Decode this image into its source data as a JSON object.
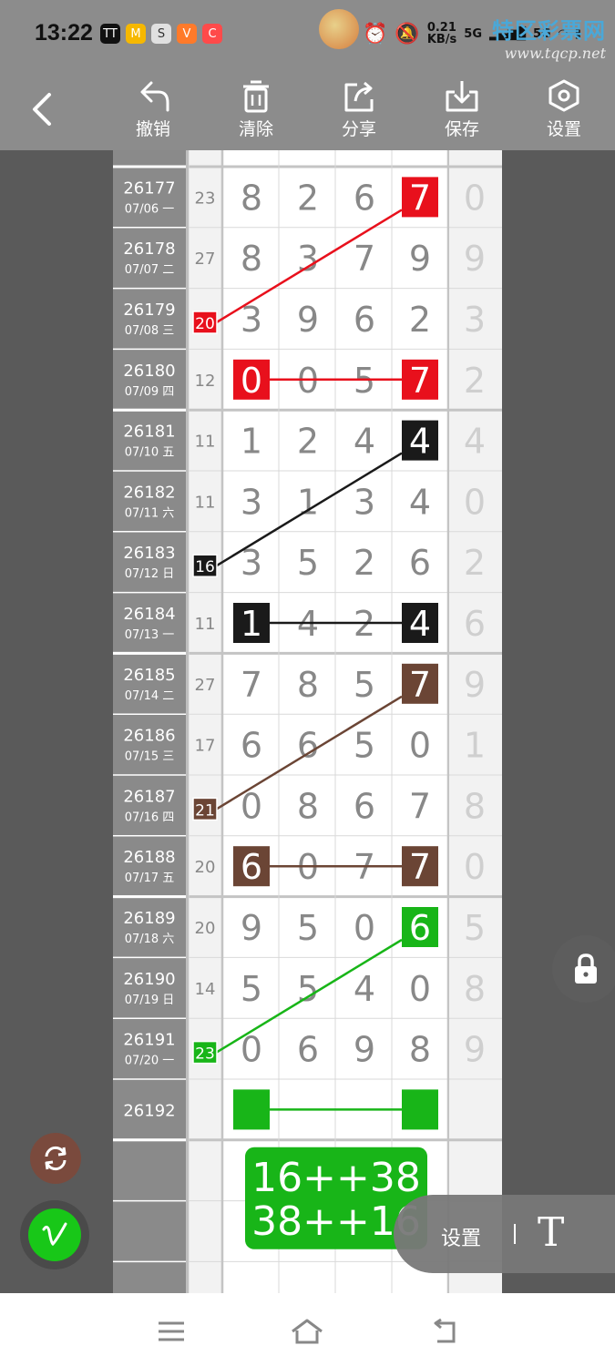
{
  "status": {
    "time": "13:22",
    "app_icons": [
      "TT",
      "M",
      "S",
      "V",
      "C"
    ],
    "speed_value": "0.21",
    "speed_unit": "KB/s",
    "net1": "5G",
    "net2": "5G"
  },
  "watermark": {
    "title": "特区彩票网",
    "url": "www.tqcp.net"
  },
  "toolbar": {
    "undo": "撤销",
    "clear": "清除",
    "share": "分享",
    "save": "保存",
    "settings": "设置"
  },
  "rows": [
    {
      "issue": "26177",
      "date": "07/06 一",
      "sum": "23",
      "digits": [
        "8",
        "2",
        "6",
        "7"
      ],
      "next": "0"
    },
    {
      "issue": "26178",
      "date": "07/07 二",
      "sum": "27",
      "digits": [
        "8",
        "3",
        "7",
        "9"
      ],
      "next": "9"
    },
    {
      "issue": "26179",
      "date": "07/08 三",
      "sum": "20",
      "digits": [
        "3",
        "9",
        "6",
        "2"
      ],
      "next": "3"
    },
    {
      "issue": "26180",
      "date": "07/09 四",
      "sum": "12",
      "digits": [
        "0",
        "0",
        "5",
        "7"
      ],
      "next": "2"
    },
    {
      "issue": "26181",
      "date": "07/10 五",
      "sum": "11",
      "digits": [
        "1",
        "2",
        "4",
        "4"
      ],
      "next": "4"
    },
    {
      "issue": "26182",
      "date": "07/11 六",
      "sum": "11",
      "digits": [
        "3",
        "1",
        "3",
        "4"
      ],
      "next": "0"
    },
    {
      "issue": "26183",
      "date": "07/12 日",
      "sum": "16",
      "digits": [
        "3",
        "5",
        "2",
        "6"
      ],
      "next": "2"
    },
    {
      "issue": "26184",
      "date": "07/13 一",
      "sum": "11",
      "digits": [
        "1",
        "4",
        "2",
        "4"
      ],
      "next": "6"
    },
    {
      "issue": "26185",
      "date": "07/14 二",
      "sum": "27",
      "digits": [
        "7",
        "8",
        "5",
        "7"
      ],
      "next": "9"
    },
    {
      "issue": "26186",
      "date": "07/15 三",
      "sum": "17",
      "digits": [
        "6",
        "6",
        "5",
        "0"
      ],
      "next": "1"
    },
    {
      "issue": "26187",
      "date": "07/16 四",
      "sum": "21",
      "digits": [
        "0",
        "8",
        "6",
        "7"
      ],
      "next": "8"
    },
    {
      "issue": "26188",
      "date": "07/17 五",
      "sum": "20",
      "digits": [
        "6",
        "0",
        "7",
        "7"
      ],
      "next": "0"
    },
    {
      "issue": "26189",
      "date": "07/18 六",
      "sum": "20",
      "digits": [
        "9",
        "5",
        "0",
        "6"
      ],
      "next": "5"
    },
    {
      "issue": "26190",
      "date": "07/19 日",
      "sum": "14",
      "digits": [
        "5",
        "5",
        "4",
        "0"
      ],
      "next": "8"
    },
    {
      "issue": "26191",
      "date": "07/20 一",
      "sum": "23",
      "digits": [
        "0",
        "6",
        "9",
        "8"
      ],
      "next": "9"
    },
    {
      "issue": "26192",
      "date": "",
      "sum": "",
      "digits": [
        "",
        "",
        "",
        ""
      ],
      "next": ""
    }
  ],
  "groups": [
    {
      "color": "#e8101c",
      "sum_label": "20",
      "first": "0",
      "last": "7"
    },
    {
      "color": "#1a1a1a",
      "sum_label": "16",
      "first": "1",
      "last": "4"
    },
    {
      "color": "#6b4535",
      "sum_label": "21",
      "first": "6",
      "last": "7"
    },
    {
      "color": "#18b518",
      "sum_label": "23",
      "first": "",
      "last": ""
    }
  ],
  "result": {
    "line1": "16++38",
    "line2": "38++16",
    "color": "#18b518"
  },
  "popup": {
    "label": "设置"
  },
  "colors": {
    "grey_cell": "#8a8a8a",
    "line_grey": "#d9d9d9",
    "sum_col": "#f2f2f2",
    "next_col": "#f2f2f2"
  }
}
